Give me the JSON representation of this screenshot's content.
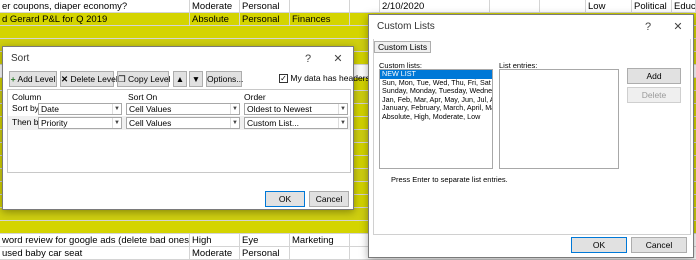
{
  "spreadsheet": {
    "top_rows": [
      {
        "a": "er coupons, diaper economy?",
        "b": "Moderate",
        "c": "Personal",
        "d": "",
        "e": "",
        "f": "2/10/2020",
        "g": "",
        "h": "",
        "i": "Low",
        "j": "Political",
        "k": "Educat"
      },
      {
        "a": "d Gerard P&L for Q 2019",
        "b": "Absolute",
        "c": "Personal",
        "d": "Finances"
      }
    ],
    "bottom_rows": [
      {
        "a": "word review for google ads (delete bad ones)",
        "b": "High",
        "c": "Eye",
        "d": "Marketing"
      },
      {
        "a": "used baby car seat",
        "b": "Moderate",
        "c": "Personal",
        "d": ""
      }
    ]
  },
  "sort_dialog": {
    "title": "Sort",
    "help": "?",
    "close": "✕",
    "toolbar": {
      "add_level": "Add Level",
      "delete_level": "Delete Level",
      "copy_level": "Copy Level",
      "options": "Options...",
      "headers_label": "My data has headers",
      "headers_checked": true
    },
    "headers": {
      "column": "Column",
      "sort_on": "Sort On",
      "order": "Order"
    },
    "levels": [
      {
        "prefix": "Sort by",
        "column": "Date",
        "sort_on": "Cell Values",
        "order": "Oldest to Newest"
      },
      {
        "prefix": "Then by",
        "column": "Priority",
        "sort_on": "Cell Values",
        "order": "Custom List..."
      }
    ],
    "ok": "OK",
    "cancel": "Cancel"
  },
  "custom_lists_dialog": {
    "title": "Custom Lists",
    "help": "?",
    "close": "✕",
    "tab": "Custom Lists",
    "lists_label": "Custom lists:",
    "entries_label": "List entries:",
    "lists": [
      "NEW LIST",
      "Sun, Mon, Tue, Wed, Thu, Fri, Sat",
      "Sunday, Monday, Tuesday, Wednes",
      "Jan, Feb, Mar, Apr, May, Jun, Jul, Au",
      "January, February, March, April, Ma",
      "Absolute, High, Moderate, Low"
    ],
    "selected_index": 0,
    "add": "Add",
    "delete": "Delete",
    "hint": "Press Enter to separate list entries.",
    "ok": "OK",
    "cancel": "Cancel"
  },
  "colors": {
    "highlight": "#d4d400",
    "accent": "#0078d7"
  }
}
